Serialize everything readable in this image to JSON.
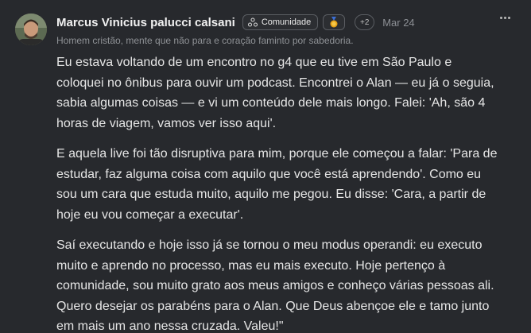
{
  "post": {
    "author": "Marcus Vinicius palucci calsani",
    "community_badge": "Comunidade",
    "extra_badges": "+2",
    "date": "Mar 24",
    "bio": "Homem cristão, mente que não para e coração faminto por sabedoria.",
    "paragraphs": [
      "Eu estava voltando de um encontro no g4 que eu tive em São Paulo e coloquei no ônibus para ouvir um podcast. Encontrei o Alan — eu já o seguia, sabia algumas coisas — e vi um conteúdo dele mais longo. Falei: 'Ah, são 4 horas de viagem, vamos ver isso aqui'.",
      "E aquela live foi tão disruptiva para mim, porque ele começou a falar: 'Para de estudar, faz alguma coisa com aquilo que você está aprendendo'. Como eu sou um cara que estuda muito, aquilo me pegou. Eu disse: 'Cara, a partir de hoje eu vou começar a executar'.",
      "Saí executando e hoje isso já se tornou o meu modus operandi: eu executo muito e aprendo no processo, mas eu mais executo. Hoje pertenço à comunidade, sou muito grato aos meus amigos e conheço várias pessoas ali. Quero desejar os parabéns para o Alan. Que Deus abençoe ele e tamo junto em mais um ano nessa cruzada. Valeu!\""
    ]
  },
  "icons": {
    "community": "community-icon",
    "medal": "medal-icon",
    "menu": "more-options-icon"
  },
  "colors": {
    "background": "#27292d",
    "text": "#e6e6e6",
    "muted": "#8f9296",
    "medal": "#e8a316"
  }
}
